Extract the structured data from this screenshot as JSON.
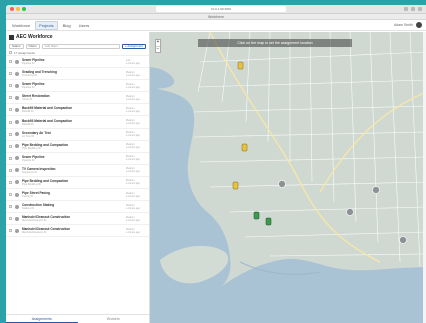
{
  "browser": {
    "url": "10.0.1.99:3000",
    "tab_title": "Workforce"
  },
  "appbar": {
    "nav": [
      "Workforce",
      "Projects",
      "Blog",
      "Users"
    ],
    "active_nav": 1,
    "user_name": "Adam Smith"
  },
  "panel": {
    "title": "AEC Workforce",
    "filter_button_1": "Status",
    "filter_button_2": "Filters",
    "search_placeholder": "Add filters",
    "add_button": "+ Assignment",
    "count_label": "17 assignments"
  },
  "assignments": [
    {
      "title": "Sewer Pipeline",
      "sub": "Pipeline ID",
      "m1": "Low",
      "m2": "a minute ago"
    },
    {
      "title": "Grading and Trenching",
      "sub": "Trenching ID",
      "m1": "Medium",
      "m2": "a minute ago"
    },
    {
      "title": "Sewer Pipeline",
      "sub": "Pipeline ID",
      "m1": "Medium",
      "m2": "a minute ago"
    },
    {
      "title": "Street Restoration",
      "sub": "Street ID",
      "m1": "Medium",
      "m2": "a minute ago"
    },
    {
      "title": "Backfill Material and Compaction",
      "sub": "Backfill ID",
      "m1": "Medium",
      "m2": "a minute ago"
    },
    {
      "title": "Backfill Material and Compaction",
      "sub": "Backfill ID",
      "m1": "Medium",
      "m2": "a minute ago"
    },
    {
      "title": "Secondary Air Test",
      "sub": "Air Test ID",
      "m1": "Medium",
      "m2": "a minute ago"
    },
    {
      "title": "Pipe Bedding and Compaction",
      "sub": "Pipe Bedding ID",
      "m1": "Medium",
      "m2": "a minute ago"
    },
    {
      "title": "Sewer Pipeline",
      "sub": "Pipeline ID",
      "m1": "Medium",
      "m2": "a minute ago"
    },
    {
      "title": "TV Camera Inspection",
      "sub": "Inspection ID",
      "m1": "Medium",
      "m2": "a minute ago"
    },
    {
      "title": "Pipe Bedding and Compaction",
      "sub": "Pipe Bedding ID",
      "m1": "Medium",
      "m2": "a minute ago"
    },
    {
      "title": "Pipe Street Paving",
      "sub": "Paving ID",
      "m1": "Medium",
      "m2": "a minute ago"
    },
    {
      "title": "Construction Staking",
      "sub": "Staking ID",
      "m1": "Medium",
      "m2": "a minute ago"
    },
    {
      "title": "Manhole/Cleanout Construction",
      "sub": "Manhole/Cleanout ID",
      "m1": "Medium",
      "m2": "a minute ago"
    },
    {
      "title": "Manhole/Cleanout Construction",
      "sub": "Manhole/Cleanout ID",
      "m1": "Medium",
      "m2": "a minute ago"
    }
  ],
  "bottom_tabs": [
    "Assignments",
    "Workers"
  ],
  "map": {
    "banner": "Click on the map to set the assignment location",
    "zoom_in": "+",
    "zoom_out": "−"
  },
  "colors": {
    "water": "#a9c3d4",
    "land": "#cfd9d2",
    "accent": "#2c5aa0",
    "marker_yellow": "#e9c13d",
    "marker_green": "#3d9a4a",
    "marker_gray": "#8c9195"
  }
}
